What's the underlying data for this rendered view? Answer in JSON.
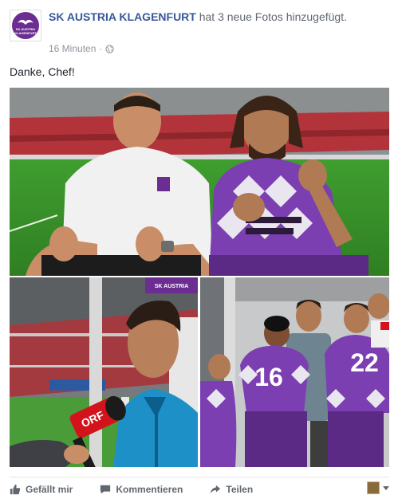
{
  "post": {
    "page_name": "SK AUSTRIA KLAGENFURT",
    "action_text": " hat 3 neue Fotos hinzugefügt.",
    "timestamp": "16 Minuten",
    "separator": "·",
    "privacy_icon": "globe-icon",
    "message": "Danke, Chef!"
  },
  "avatar": {
    "logo_text_line1": "SK AUSTRIA",
    "logo_text_line2": "KLAGENFURT",
    "brand_color": "#6b2d91"
  },
  "photos": {
    "left_interview": {
      "mic_logo": "ORF",
      "banner_text": "SK AUSTRIA"
    },
    "right_team": {
      "jersey_numbers": [
        "16",
        "22"
      ]
    }
  },
  "actions": {
    "like_label": "Gefällt mir",
    "comment_label": "Kommentieren",
    "share_label": "Teilen"
  },
  "colors": {
    "link": "#365899",
    "secondary_text": "#616770",
    "meta_text": "#90949c",
    "purple_jersey": "#7b3fb2"
  }
}
